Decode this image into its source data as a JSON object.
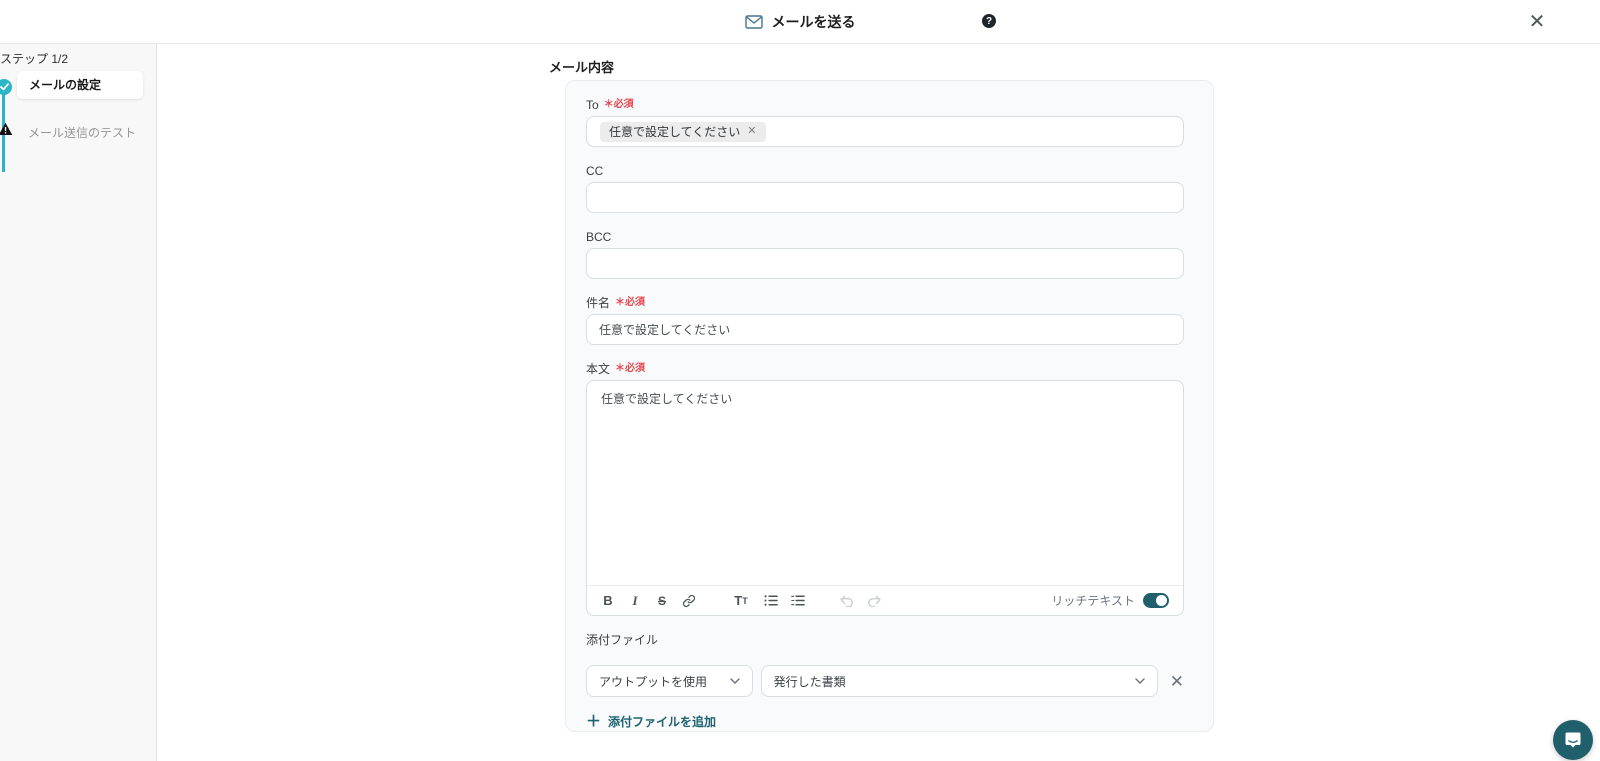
{
  "header": {
    "title": "メールを送る",
    "help_label": "?",
    "close_label": "✕"
  },
  "sidebar": {
    "step_counter": "ステップ 1/2",
    "steps": [
      {
        "label": "メールの設定",
        "state": "active"
      },
      {
        "label": "メール送信のテスト",
        "state": "pending"
      }
    ]
  },
  "main": {
    "section_title": "メール内容",
    "required_label": "＊必須",
    "to": {
      "label": "To",
      "chip_text": "任意で設定してください",
      "chip_remove": "✕"
    },
    "cc": {
      "label": "CC",
      "value": ""
    },
    "bcc": {
      "label": "BCC",
      "value": ""
    },
    "subject": {
      "label": "件名",
      "value": "任意で設定してください"
    },
    "body": {
      "label": "本文",
      "value": "任意で設定してください",
      "richtext_label": "リッチテキスト",
      "richtext_on": true
    },
    "attachments": {
      "label": "添付ファイル",
      "source_select_value": "アウトプットを使用",
      "doc_select_value": "発行した書類",
      "remove_label": "✕",
      "add_label": "添付ファイルを追加",
      "add_plus": "＋"
    }
  },
  "colors": {
    "accent": "#2BB5C6",
    "accent_dark": "#20606C",
    "required_red": "#E5484D"
  }
}
